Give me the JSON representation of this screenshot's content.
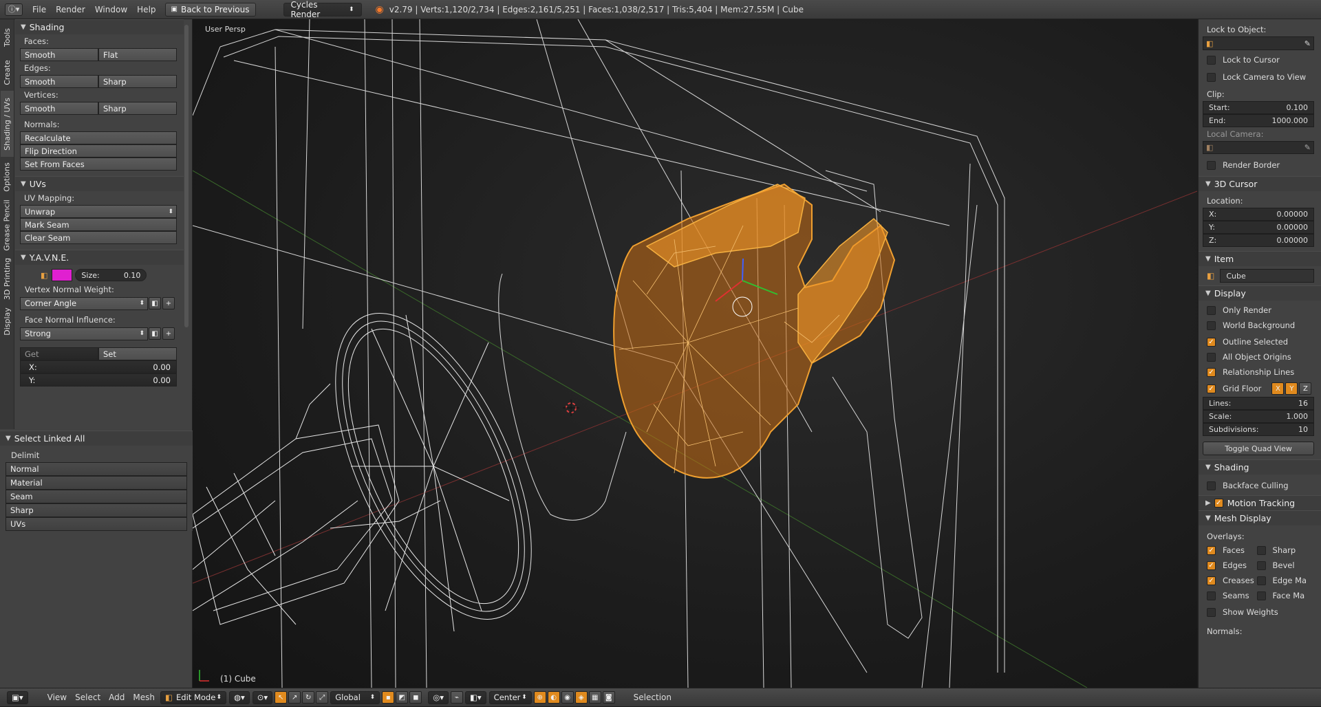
{
  "topbar": {
    "menus": [
      "File",
      "Render",
      "Window",
      "Help"
    ],
    "back_label": "Back to Previous",
    "engine": "Cycles Render",
    "stats": "v2.79 | Verts:1,120/2,734 | Edges:2,161/5,251 | Faces:1,038/2,517 | Tris:5,404 | Mem:27.55M | Cube"
  },
  "vtabs": [
    "Tools",
    "Create",
    "Shading / UVs",
    "Options",
    "Grease Pencil",
    "3D Printing",
    "Display"
  ],
  "shading_panel": {
    "title": "Shading",
    "faces_label": "Faces:",
    "faces": [
      "Smooth",
      "Flat"
    ],
    "edges_label": "Edges:",
    "edges": [
      "Smooth",
      "Sharp"
    ],
    "vertices_label": "Vertices:",
    "vertices": [
      "Smooth",
      "Sharp"
    ],
    "normals_label": "Normals:",
    "normals": [
      "Recalculate",
      "Flip Direction",
      "Set From Faces"
    ]
  },
  "uvs_panel": {
    "title": "UVs",
    "mapping_label": "UV Mapping:",
    "unwrap": "Unwrap",
    "mark_seam": "Mark Seam",
    "clear_seam": "Clear Seam"
  },
  "yavne_panel": {
    "title": "Y.A.V.N.E.",
    "size_label": "Size:",
    "size_value": "0.10",
    "color": "#e020d0",
    "vnw_label": "Vertex Normal Weight:",
    "vnw_value": "Corner Angle",
    "fni_label": "Face Normal Influence:",
    "fni_value": "Strong",
    "get": "Get",
    "set": "Set",
    "x_label": "X:",
    "x_value": "0.00",
    "y_label": "Y:",
    "y_value": "0.00"
  },
  "select_linked": {
    "title": "Select Linked All",
    "delimit_label": "Delimit",
    "options": [
      "Normal",
      "Material",
      "Seam",
      "Sharp",
      "UVs"
    ]
  },
  "viewport": {
    "view_name": "User Persp",
    "object_label": "(1) Cube"
  },
  "right_panel": {
    "lock_to_object": "Lock to Object:",
    "lock_to_cursor": "Lock to Cursor",
    "lock_camera": "Lock Camera to View",
    "clip_label": "Clip:",
    "clip_start_label": "Start:",
    "clip_start": "0.100",
    "clip_end_label": "End:",
    "clip_end": "1000.000",
    "local_camera": "Local Camera:",
    "render_border": "Render Border",
    "cursor_title": "3D Cursor",
    "location_label": "Location:",
    "cx_label": "X:",
    "cx": "0.00000",
    "cy_label": "Y:",
    "cy": "0.00000",
    "cz_label": "Z:",
    "cz": "0.00000",
    "item_title": "Item",
    "item_name": "Cube",
    "display_title": "Display",
    "only_render": "Only Render",
    "world_background": "World Background",
    "outline_selected": "Outline Selected",
    "all_origins": "All Object Origins",
    "relationship_lines": "Relationship Lines",
    "grid_floor": "Grid Floor",
    "axis_x": "X",
    "axis_y": "Y",
    "axis_z": "Z",
    "lines_label": "Lines:",
    "lines": "16",
    "scale_label": "Scale:",
    "scale": "1.000",
    "subdiv_label": "Subdivisions:",
    "subdiv": "10",
    "toggle_quad": "Toggle Quad View",
    "shading_title": "Shading",
    "backface": "Backface Culling",
    "motion_tracking": "Motion Tracking",
    "mesh_display_title": "Mesh Display",
    "overlays_label": "Overlays:",
    "ov_faces": "Faces",
    "ov_sharp": "Sharp",
    "ov_edges": "Edges",
    "ov_bevel": "Bevel",
    "ov_creases": "Creases",
    "ov_edgema": "Edge Ma",
    "ov_seams": "Seams",
    "ov_facema": "Face Ma",
    "show_weights": "Show Weights",
    "normals_label": "Normals:"
  },
  "bottombar": {
    "menus": [
      "View",
      "Select",
      "Add",
      "Mesh"
    ],
    "mode": "Edit Mode",
    "orientation": "Global",
    "pivot": "Center",
    "status": "Selection"
  },
  "colors": {
    "accent": "#e08a1e",
    "selection": "#f0a030"
  }
}
